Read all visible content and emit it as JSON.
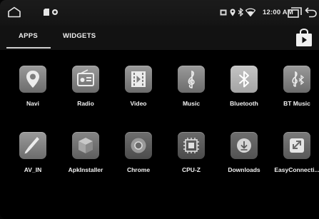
{
  "status_bar": {
    "time": "12:00 AM",
    "icons": [
      "home-icon",
      "sd-card-icon",
      "record-dot-icon",
      "screenshot-icon",
      "location-icon",
      "bluetooth-status-icon",
      "wifi-icon",
      "recent-apps-icon",
      "back-icon"
    ]
  },
  "tabs": [
    {
      "label": "APPS",
      "active": true
    },
    {
      "label": "WIDGETS",
      "active": false
    }
  ],
  "store_icon": "play-store-bag-icon",
  "apps": [
    {
      "label": "Navi",
      "icon": "map-pin-icon"
    },
    {
      "label": "Radio",
      "icon": "radio-icon"
    },
    {
      "label": "Video",
      "icon": "film-icon"
    },
    {
      "label": "Music",
      "icon": "treble-clef-icon"
    },
    {
      "label": "Bluetooth",
      "icon": "bluetooth-icon"
    },
    {
      "label": "BT Music",
      "icon": "bt-music-icon"
    },
    {
      "label": "AV_IN",
      "icon": "av-in-icon"
    },
    {
      "label": "ApkInstaller",
      "icon": "package-cube-icon"
    },
    {
      "label": "Chrome",
      "icon": "chrome-icon"
    },
    {
      "label": "CPU-Z",
      "icon": "cpu-chip-icon"
    },
    {
      "label": "Downloads",
      "icon": "download-icon"
    },
    {
      "label": "EasyConnecti...",
      "icon": "easyconnect-icon"
    }
  ],
  "colors": {
    "background": "#000000",
    "status_bar": "#171717",
    "tab_bar": "#121212",
    "icon_tile": "#8a8a8a",
    "text": "#f2f2f2"
  }
}
